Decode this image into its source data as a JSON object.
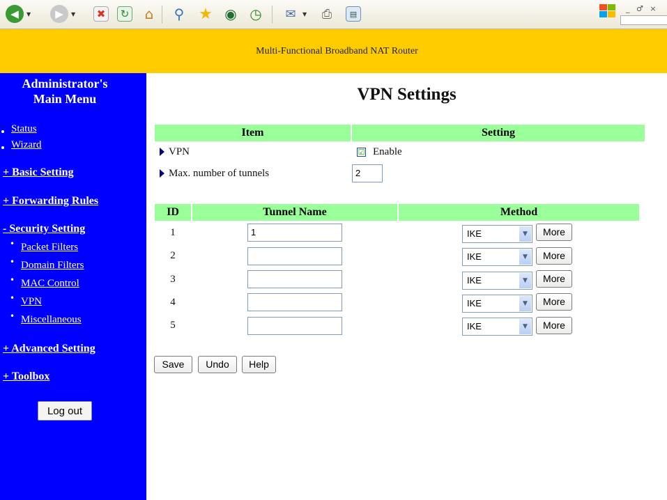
{
  "browser": {
    "window_controls": "_ ♂ ×"
  },
  "banner": {
    "title": "Multi-Functional Broadband NAT Router"
  },
  "sidebar": {
    "title_line1": "Administrator's",
    "title_line2": "Main Menu",
    "status": "Status",
    "wizard": "Wizard",
    "basic_setting": "+ Basic Setting",
    "forwarding_rules": "+ Forwarding Rules",
    "security_setting": "- Security Setting",
    "packet_filters": "Packet Filters",
    "domain_filters": "Domain Filters",
    "mac_control": "MAC Control",
    "vpn": "VPN",
    "miscellaneous": "Miscellaneous",
    "advanced_setting": "+ Advanced Setting",
    "toolbox": "+ Toolbox",
    "logout": "Log out"
  },
  "main": {
    "title": "VPN Settings",
    "settings_table": {
      "header_item": "Item",
      "header_setting": "Setting",
      "vpn_label": "VPN",
      "vpn_enable_label": "Enable",
      "vpn_enabled": "☑",
      "max_tunnels_label": "Max. number of tunnels",
      "max_tunnels_value": "2"
    },
    "tunnels_table": {
      "header_id": "ID",
      "header_name": "Tunnel Name",
      "header_method": "Method",
      "rows": [
        {
          "id": "1",
          "name": "1",
          "method": "IKE",
          "more": "More"
        },
        {
          "id": "2",
          "name": "",
          "method": "IKE",
          "more": "More"
        },
        {
          "id": "3",
          "name": "",
          "method": "IKE",
          "more": "More"
        },
        {
          "id": "4",
          "name": "",
          "method": "IKE",
          "more": "More"
        },
        {
          "id": "5",
          "name": "",
          "method": "IKE",
          "more": "More"
        }
      ]
    },
    "buttons": {
      "save": "Save",
      "undo": "Undo",
      "help": "Help"
    }
  },
  "colors": {
    "banner": "#ffcc00",
    "sidebar": "#0000ff",
    "table_header": "#99ff99"
  }
}
